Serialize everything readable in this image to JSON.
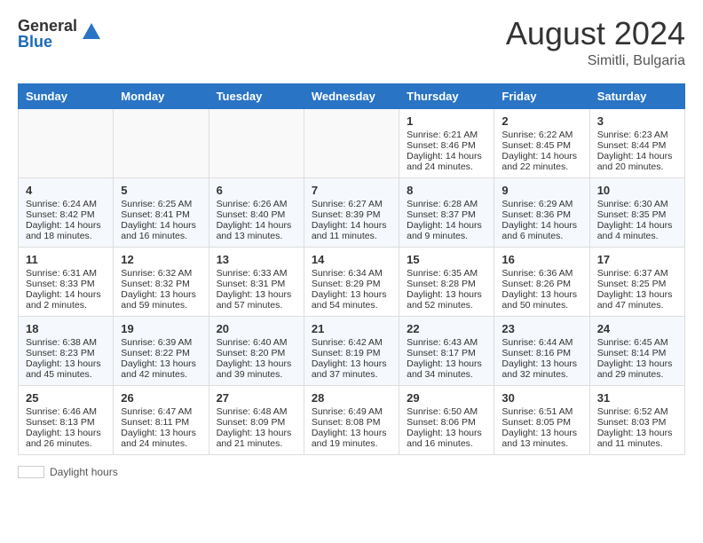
{
  "logo": {
    "general": "General",
    "blue": "Blue"
  },
  "title": {
    "month_year": "August 2024",
    "location": "Simitli, Bulgaria"
  },
  "days_of_week": [
    "Sunday",
    "Monday",
    "Tuesday",
    "Wednesday",
    "Thursday",
    "Friday",
    "Saturday"
  ],
  "weeks": [
    [
      {
        "day": "",
        "content": ""
      },
      {
        "day": "",
        "content": ""
      },
      {
        "day": "",
        "content": ""
      },
      {
        "day": "",
        "content": ""
      },
      {
        "day": "1",
        "content": "Sunrise: 6:21 AM\nSunset: 8:46 PM\nDaylight: 14 hours and 24 minutes."
      },
      {
        "day": "2",
        "content": "Sunrise: 6:22 AM\nSunset: 8:45 PM\nDaylight: 14 hours and 22 minutes."
      },
      {
        "day": "3",
        "content": "Sunrise: 6:23 AM\nSunset: 8:44 PM\nDaylight: 14 hours and 20 minutes."
      }
    ],
    [
      {
        "day": "4",
        "content": "Sunrise: 6:24 AM\nSunset: 8:42 PM\nDaylight: 14 hours and 18 minutes."
      },
      {
        "day": "5",
        "content": "Sunrise: 6:25 AM\nSunset: 8:41 PM\nDaylight: 14 hours and 16 minutes."
      },
      {
        "day": "6",
        "content": "Sunrise: 6:26 AM\nSunset: 8:40 PM\nDaylight: 14 hours and 13 minutes."
      },
      {
        "day": "7",
        "content": "Sunrise: 6:27 AM\nSunset: 8:39 PM\nDaylight: 14 hours and 11 minutes."
      },
      {
        "day": "8",
        "content": "Sunrise: 6:28 AM\nSunset: 8:37 PM\nDaylight: 14 hours and 9 minutes."
      },
      {
        "day": "9",
        "content": "Sunrise: 6:29 AM\nSunset: 8:36 PM\nDaylight: 14 hours and 6 minutes."
      },
      {
        "day": "10",
        "content": "Sunrise: 6:30 AM\nSunset: 8:35 PM\nDaylight: 14 hours and 4 minutes."
      }
    ],
    [
      {
        "day": "11",
        "content": "Sunrise: 6:31 AM\nSunset: 8:33 PM\nDaylight: 14 hours and 2 minutes."
      },
      {
        "day": "12",
        "content": "Sunrise: 6:32 AM\nSunset: 8:32 PM\nDaylight: 13 hours and 59 minutes."
      },
      {
        "day": "13",
        "content": "Sunrise: 6:33 AM\nSunset: 8:31 PM\nDaylight: 13 hours and 57 minutes."
      },
      {
        "day": "14",
        "content": "Sunrise: 6:34 AM\nSunset: 8:29 PM\nDaylight: 13 hours and 54 minutes."
      },
      {
        "day": "15",
        "content": "Sunrise: 6:35 AM\nSunset: 8:28 PM\nDaylight: 13 hours and 52 minutes."
      },
      {
        "day": "16",
        "content": "Sunrise: 6:36 AM\nSunset: 8:26 PM\nDaylight: 13 hours and 50 minutes."
      },
      {
        "day": "17",
        "content": "Sunrise: 6:37 AM\nSunset: 8:25 PM\nDaylight: 13 hours and 47 minutes."
      }
    ],
    [
      {
        "day": "18",
        "content": "Sunrise: 6:38 AM\nSunset: 8:23 PM\nDaylight: 13 hours and 45 minutes."
      },
      {
        "day": "19",
        "content": "Sunrise: 6:39 AM\nSunset: 8:22 PM\nDaylight: 13 hours and 42 minutes."
      },
      {
        "day": "20",
        "content": "Sunrise: 6:40 AM\nSunset: 8:20 PM\nDaylight: 13 hours and 39 minutes."
      },
      {
        "day": "21",
        "content": "Sunrise: 6:42 AM\nSunset: 8:19 PM\nDaylight: 13 hours and 37 minutes."
      },
      {
        "day": "22",
        "content": "Sunrise: 6:43 AM\nSunset: 8:17 PM\nDaylight: 13 hours and 34 minutes."
      },
      {
        "day": "23",
        "content": "Sunrise: 6:44 AM\nSunset: 8:16 PM\nDaylight: 13 hours and 32 minutes."
      },
      {
        "day": "24",
        "content": "Sunrise: 6:45 AM\nSunset: 8:14 PM\nDaylight: 13 hours and 29 minutes."
      }
    ],
    [
      {
        "day": "25",
        "content": "Sunrise: 6:46 AM\nSunset: 8:13 PM\nDaylight: 13 hours and 26 minutes."
      },
      {
        "day": "26",
        "content": "Sunrise: 6:47 AM\nSunset: 8:11 PM\nDaylight: 13 hours and 24 minutes."
      },
      {
        "day": "27",
        "content": "Sunrise: 6:48 AM\nSunset: 8:09 PM\nDaylight: 13 hours and 21 minutes."
      },
      {
        "day": "28",
        "content": "Sunrise: 6:49 AM\nSunset: 8:08 PM\nDaylight: 13 hours and 19 minutes."
      },
      {
        "day": "29",
        "content": "Sunrise: 6:50 AM\nSunset: 8:06 PM\nDaylight: 13 hours and 16 minutes."
      },
      {
        "day": "30",
        "content": "Sunrise: 6:51 AM\nSunset: 8:05 PM\nDaylight: 13 hours and 13 minutes."
      },
      {
        "day": "31",
        "content": "Sunrise: 6:52 AM\nSunset: 8:03 PM\nDaylight: 13 hours and 11 minutes."
      }
    ]
  ],
  "legend": {
    "box_label": "Daylight hours"
  }
}
